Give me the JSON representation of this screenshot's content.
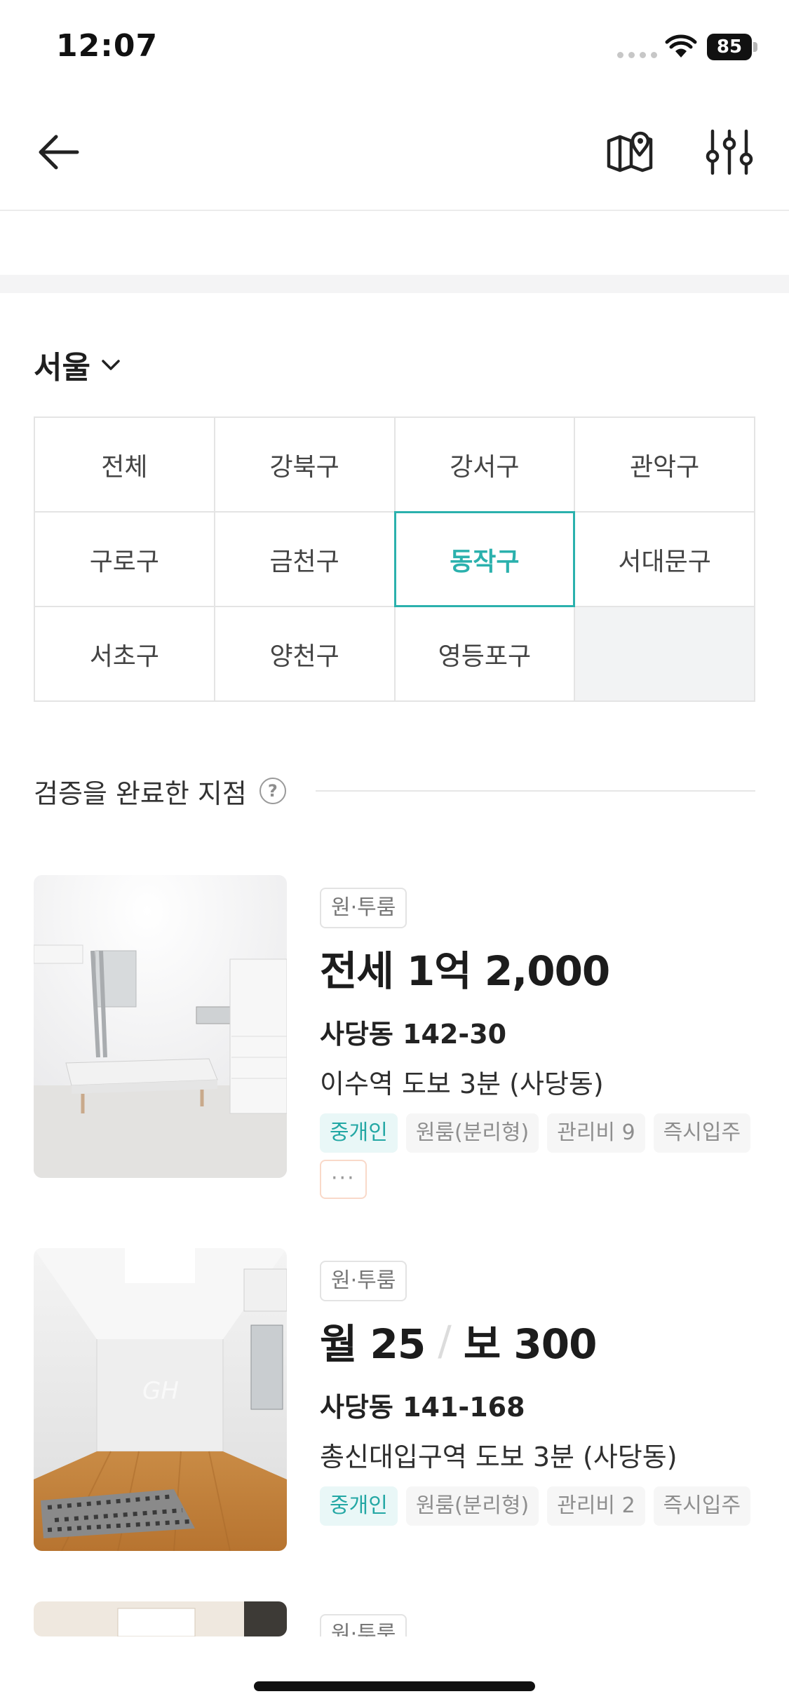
{
  "status_bar": {
    "time": "12:07",
    "battery": "85"
  },
  "nav": {
    "back": "back-arrow",
    "map": "map-pin-icon",
    "filter": "sliders-icon"
  },
  "region": {
    "name": "서울"
  },
  "districts": [
    "전체",
    "강북구",
    "강서구",
    "관악구",
    "구로구",
    "금천구",
    "동작구",
    "서대문구",
    "서초구",
    "양천구",
    "영등포구",
    ""
  ],
  "selected_district": "동작구",
  "section": {
    "title": "검증을 완료한 지점",
    "help_symbol": "?"
  },
  "listings": [
    {
      "type": "원·투룸",
      "price_main": "전세 1억 2,000",
      "address": "사당동 142-30",
      "station": "이수역 도보 3분 (사당동)",
      "tags": [
        "중개인",
        "원룸(분리형)",
        "관리비 9",
        "즉시입주"
      ],
      "more": "···"
    },
    {
      "type": "원·투룸",
      "price_main": "월 25",
      "price_sep": "/",
      "price_deposit": "보 300",
      "address": "사당동 141-168",
      "station": "총신대입구역 도보 3분 (사당동)",
      "tags": [
        "중개인",
        "원룸(분리형)",
        "관리비 2",
        "즉시입주"
      ],
      "watermark": "GH"
    },
    {
      "type": "원·투룸"
    }
  ],
  "colors": {
    "accent": "#2bb1ad",
    "agent_tag_bg": "#e9f7f7",
    "grid_border": "#e4e4e4"
  }
}
